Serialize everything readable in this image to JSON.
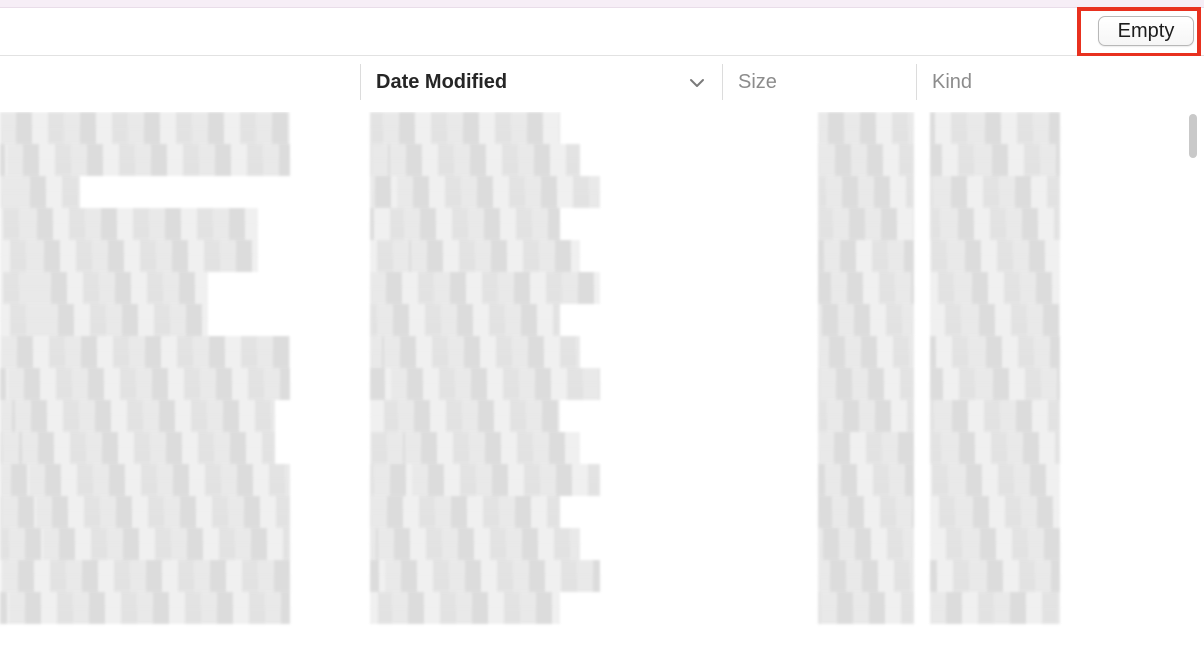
{
  "toolbar": {
    "empty_button_label": "Empty"
  },
  "columns": {
    "date_modified": "Date Modified",
    "size": "Size",
    "kind": "Kind"
  },
  "sort": {
    "active_column": "Date Modified",
    "direction_icon": "chevron-down-icon"
  },
  "colors": {
    "highlight": "#e8311f",
    "header_active_text": "#262626",
    "header_inactive_text": "#8c8c8c"
  },
  "rows": {
    "count_visible": 16,
    "content": "pixelated"
  }
}
